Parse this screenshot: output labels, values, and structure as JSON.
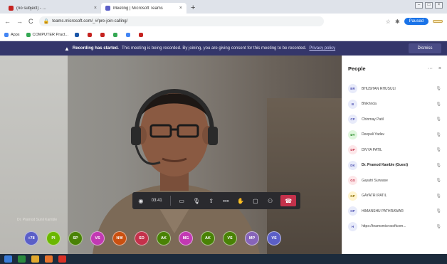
{
  "browser": {
    "tabs": [
      {
        "title": "(no subject) - ...",
        "favicon_color": "#c5221f"
      },
      {
        "title": "Meeting | Microsoft Teams",
        "favicon_color": "#5b5fc7"
      }
    ],
    "address": "teams.microsoft.com/_#/pre-join-calling/",
    "status_button": "Paused",
    "profile_button": "",
    "bookmarks": [
      {
        "label": "Apps",
        "icon_color": "#4285f4"
      },
      {
        "label": "COMPUTER Pract...",
        "icon_color": "#34a853"
      },
      {
        "label": "",
        "icon_color": "#1a56a8"
      },
      {
        "label": "",
        "icon_color": "#c5221f"
      },
      {
        "label": "",
        "icon_color": "#c5221f"
      },
      {
        "label": "",
        "icon_color": "#34a853"
      },
      {
        "label": "",
        "icon_color": "#4285f4"
      },
      {
        "label": "",
        "icon_color": "#c5221f"
      }
    ]
  },
  "banner": {
    "title": "Recording has started.",
    "message": "This meeting is being recorded. By joining, you are giving consent for this meeting to be recorded.",
    "link": "Privacy policy",
    "dismiss_label": "Dismiss"
  },
  "call": {
    "presenter_label": "Dr. Pramod Sunil Kamble",
    "timer": "03:41",
    "participants": [
      {
        "initials": "+78",
        "color": "#5b5fc7"
      },
      {
        "initials": "PI",
        "color": "#6bb700"
      },
      {
        "initials": "SP",
        "color": "#498205"
      },
      {
        "initials": "VS",
        "color": "#c239b3"
      },
      {
        "initials": "NW",
        "color": "#ca5010"
      },
      {
        "initials": "SD",
        "color": "#c4314b"
      },
      {
        "initials": "AK",
        "color": "#498205"
      },
      {
        "initials": "MG",
        "color": "#c239b3"
      },
      {
        "initials": "AK",
        "color": "#498205"
      },
      {
        "initials": "VS",
        "color": "#498205"
      },
      {
        "initials": "MP",
        "color": "#8764b8"
      },
      {
        "initials": "VS",
        "color": "#5b5fc7"
      }
    ]
  },
  "people_panel": {
    "title": "People",
    "people": [
      {
        "initials": "BR",
        "name": "BHUSHAN RHUSULI",
        "bg": "#e8ebfa",
        "fg": "#4f52b2"
      },
      {
        "initials": "B",
        "name": "Bhikhnda",
        "bg": "#e8ebfa",
        "fg": "#4f52b2"
      },
      {
        "initials": "CP",
        "name": "Chinmay Patil",
        "bg": "#e8ebfa",
        "fg": "#4f52b2"
      },
      {
        "initials": "DY",
        "name": "Deepali Yadav",
        "bg": "#dff6dd",
        "fg": "#107c10"
      },
      {
        "initials": "DP",
        "name": "DIVYA PATIL",
        "bg": "#fde7e9",
        "fg": "#c4314b"
      },
      {
        "initials": "DK",
        "name": "Dr. Pramod Kamble (Guest)",
        "bg": "#e8ebfa",
        "fg": "#4f52b2",
        "bold": true
      },
      {
        "initials": "GS",
        "name": "Gayatri Surwase",
        "bg": "#fde7e9",
        "fg": "#c4314b"
      },
      {
        "initials": "GP",
        "name": "GAYATRI PATIL",
        "bg": "#fff4ce",
        "fg": "#8a6d00"
      },
      {
        "initials": "HP",
        "name": "HIMANSHU PATHRAWAR",
        "bg": "#e8ebfa",
        "fg": "#4f52b2"
      },
      {
        "initials": "H",
        "name": "https://teamsmicrosoftcom...",
        "bg": "#e8ebfa",
        "fg": "#4f52b2"
      }
    ]
  },
  "taskbar": {
    "icons": [
      {
        "color": "#3b7dd8"
      },
      {
        "color": "#2b8a3e"
      },
      {
        "color": "#e0a82e"
      },
      {
        "color": "#e8742c"
      },
      {
        "color": "#d93025"
      }
    ],
    "tray": ""
  }
}
